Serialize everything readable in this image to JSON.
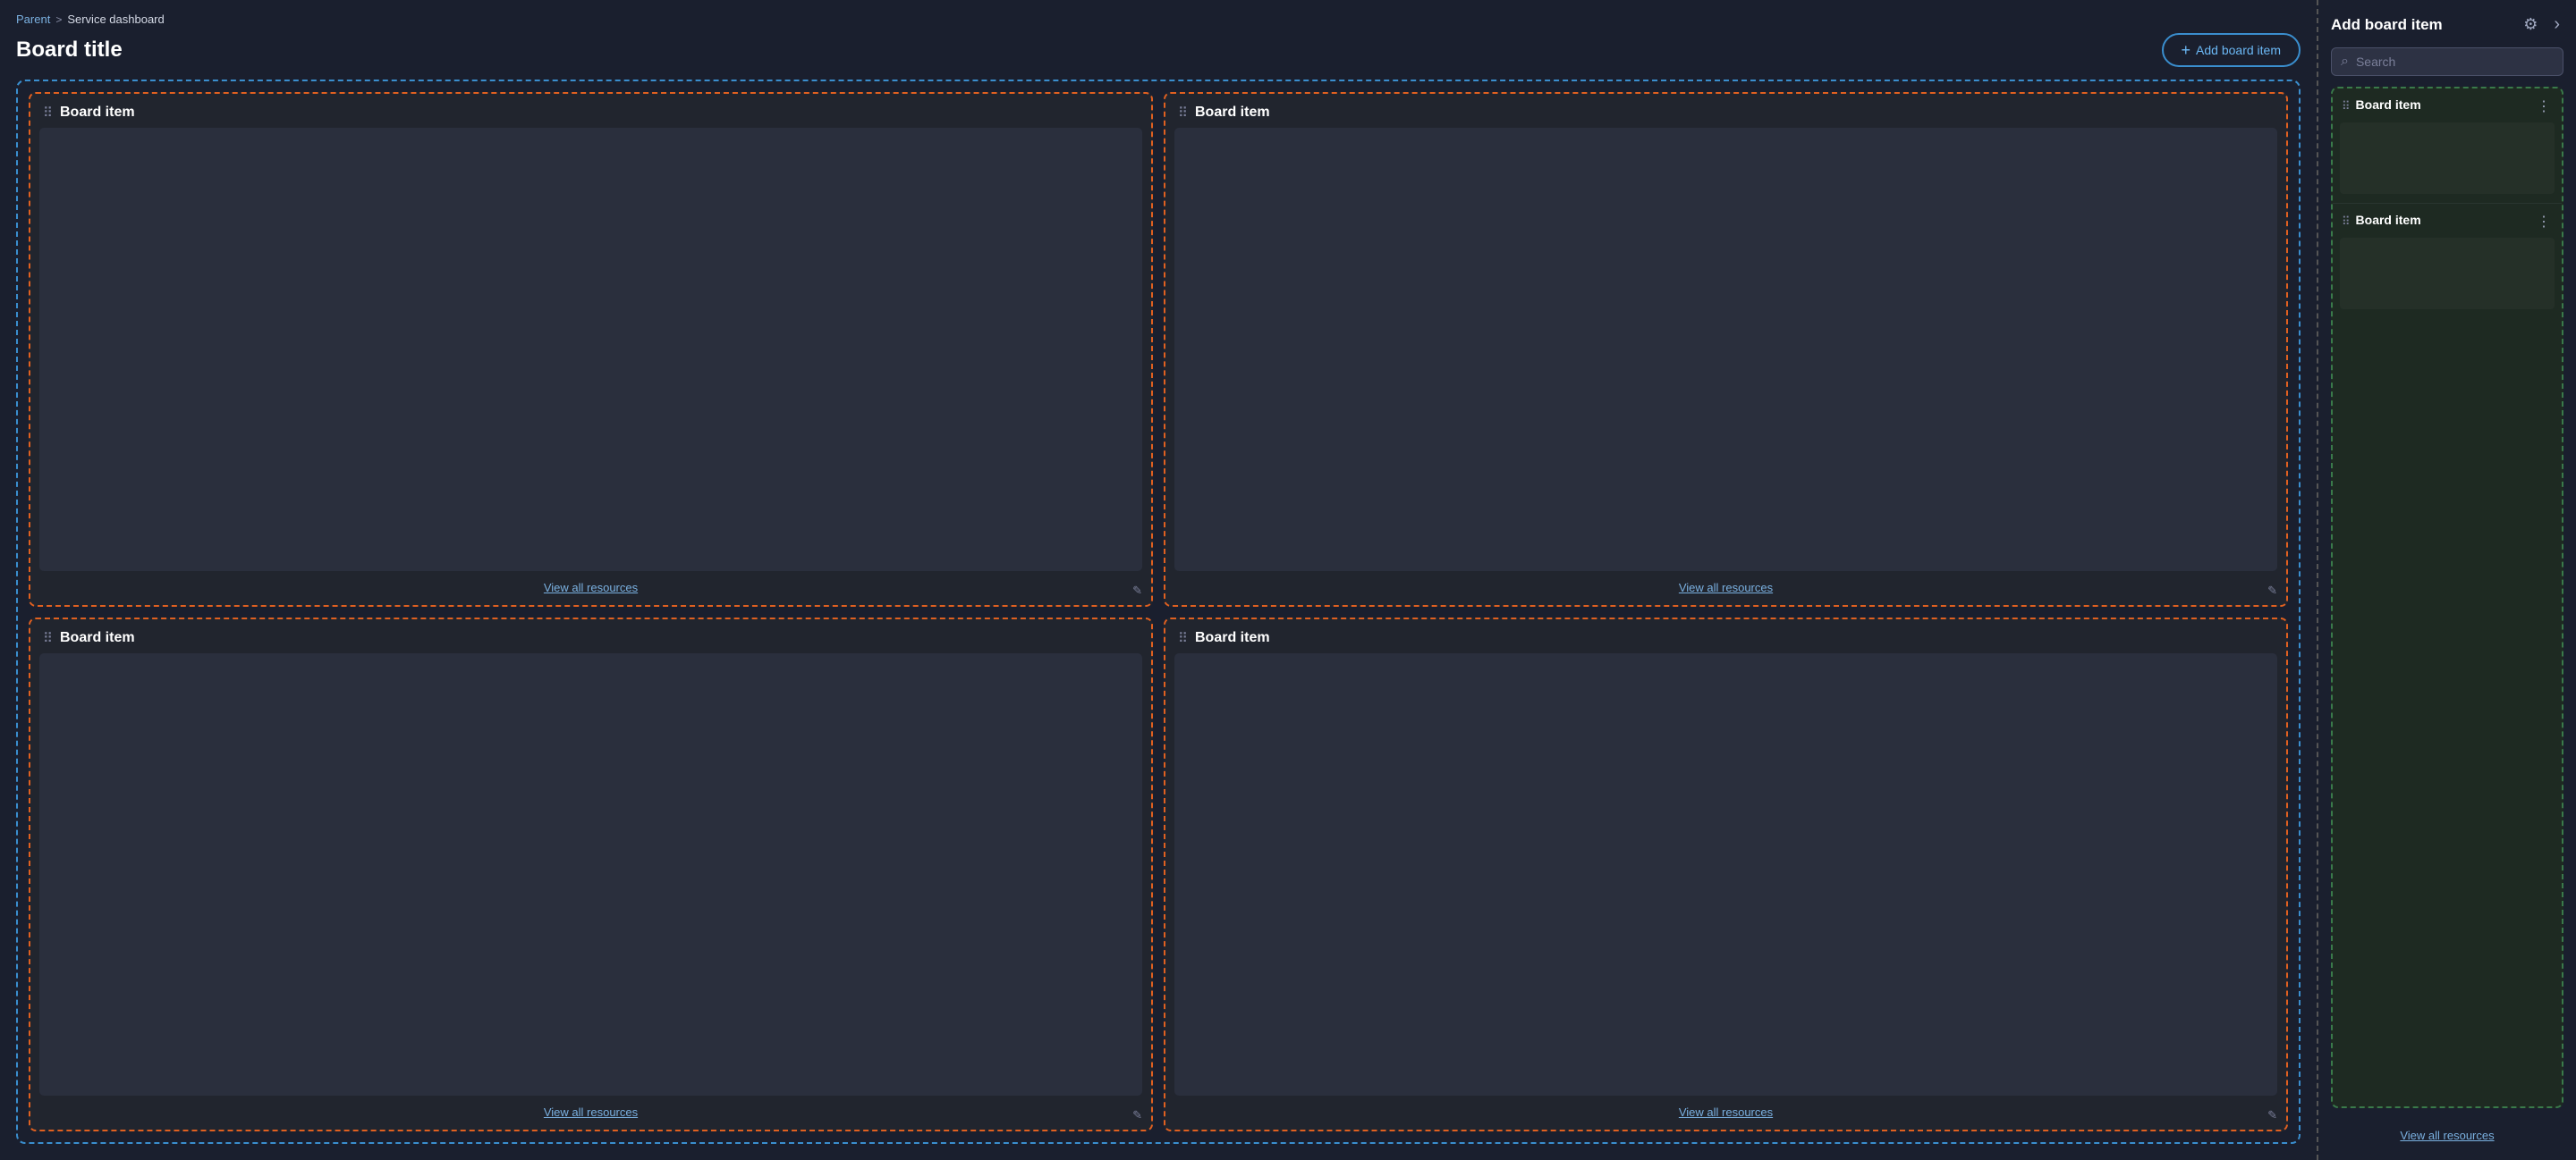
{
  "breadcrumb": {
    "parent_label": "Parent",
    "separator": ">",
    "current": "Service dashboard"
  },
  "page": {
    "title": "Board title"
  },
  "add_button": {
    "label": "Add board item",
    "plus": "+"
  },
  "board_items": [
    {
      "id": 1,
      "title": "Board item",
      "view_link": "View all resources"
    },
    {
      "id": 2,
      "title": "Board item",
      "view_link": "View all resources"
    },
    {
      "id": 3,
      "title": "Board item",
      "view_link": "View all resources"
    },
    {
      "id": 4,
      "title": "Board item",
      "view_link": "View all resources"
    }
  ],
  "right_panel": {
    "title": "Add board item",
    "search_placeholder": "Search",
    "items": [
      {
        "id": 1,
        "title": "Board item"
      },
      {
        "id": 2,
        "title": "Board item"
      }
    ],
    "view_all_label": "View all resources"
  }
}
